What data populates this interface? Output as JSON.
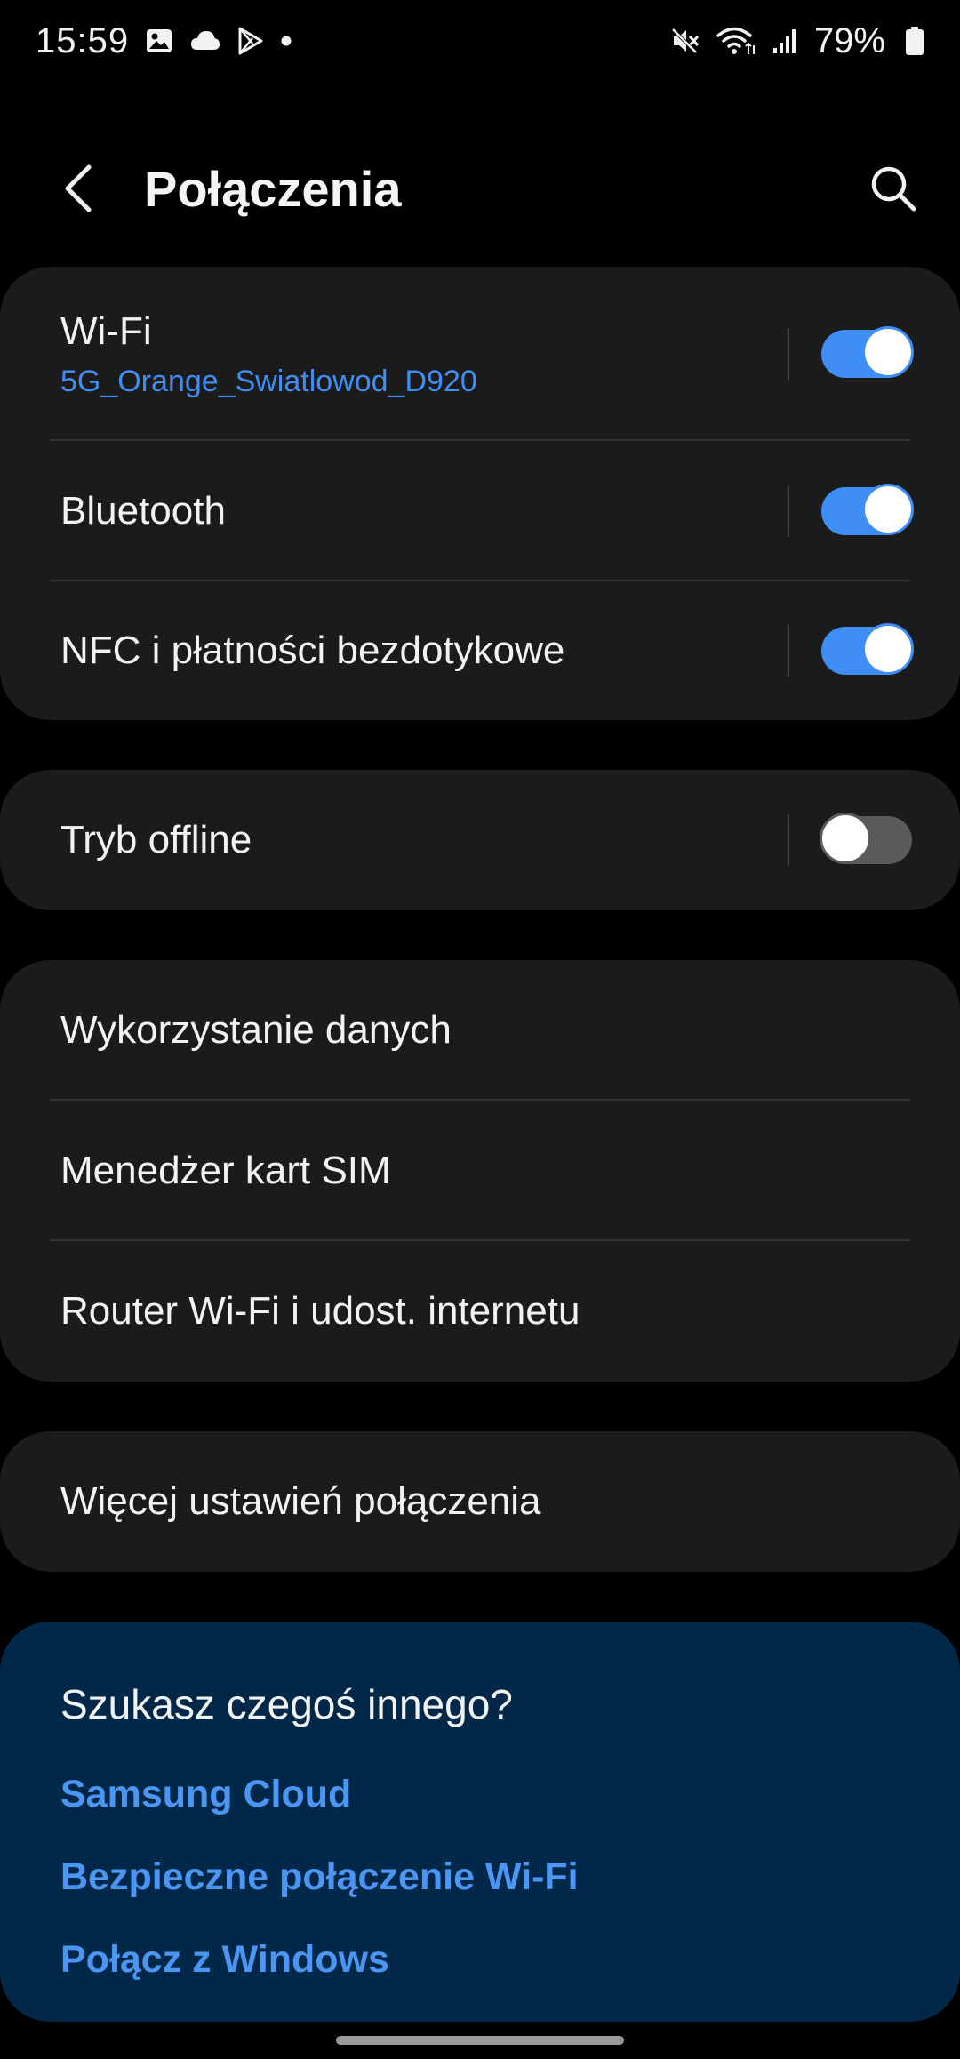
{
  "status_bar": {
    "time": "15:59",
    "battery": "79%",
    "icons_left": [
      "image-icon",
      "cloud-icon",
      "play-store-icon",
      "dot-icon"
    ],
    "icons_right": [
      "mute-icon",
      "wifi-icon",
      "signal-icon",
      "battery-icon"
    ]
  },
  "header": {
    "title": "Połączenia"
  },
  "groups": {
    "main": {
      "wifi": {
        "label": "Wi-Fi",
        "subtitle": "5G_Orange_Swiatlowod_D920",
        "enabled": true
      },
      "bluetooth": {
        "label": "Bluetooth",
        "enabled": true
      },
      "nfc": {
        "label": "NFC i płatności bezdotykowe",
        "enabled": true
      }
    },
    "offline": {
      "airplane": {
        "label": "Tryb offline",
        "enabled": false
      }
    },
    "network": {
      "data_usage": {
        "label": "Wykorzystanie danych"
      },
      "sim_manager": {
        "label": "Menedżer kart SIM"
      },
      "hotspot": {
        "label": "Router Wi-Fi i udost. internetu"
      }
    },
    "more": {
      "more_settings": {
        "label": "Więcej ustawień połączenia"
      }
    }
  },
  "suggestions": {
    "title": "Szukasz czegoś innego?",
    "links": [
      "Samsung Cloud",
      "Bezpieczne połączenie Wi-Fi",
      "Połącz z Windows"
    ]
  },
  "colors": {
    "accent": "#3e8ef5",
    "card_bg": "#1b1b1b",
    "suggest_bg": "#022849",
    "background": "#000000"
  }
}
